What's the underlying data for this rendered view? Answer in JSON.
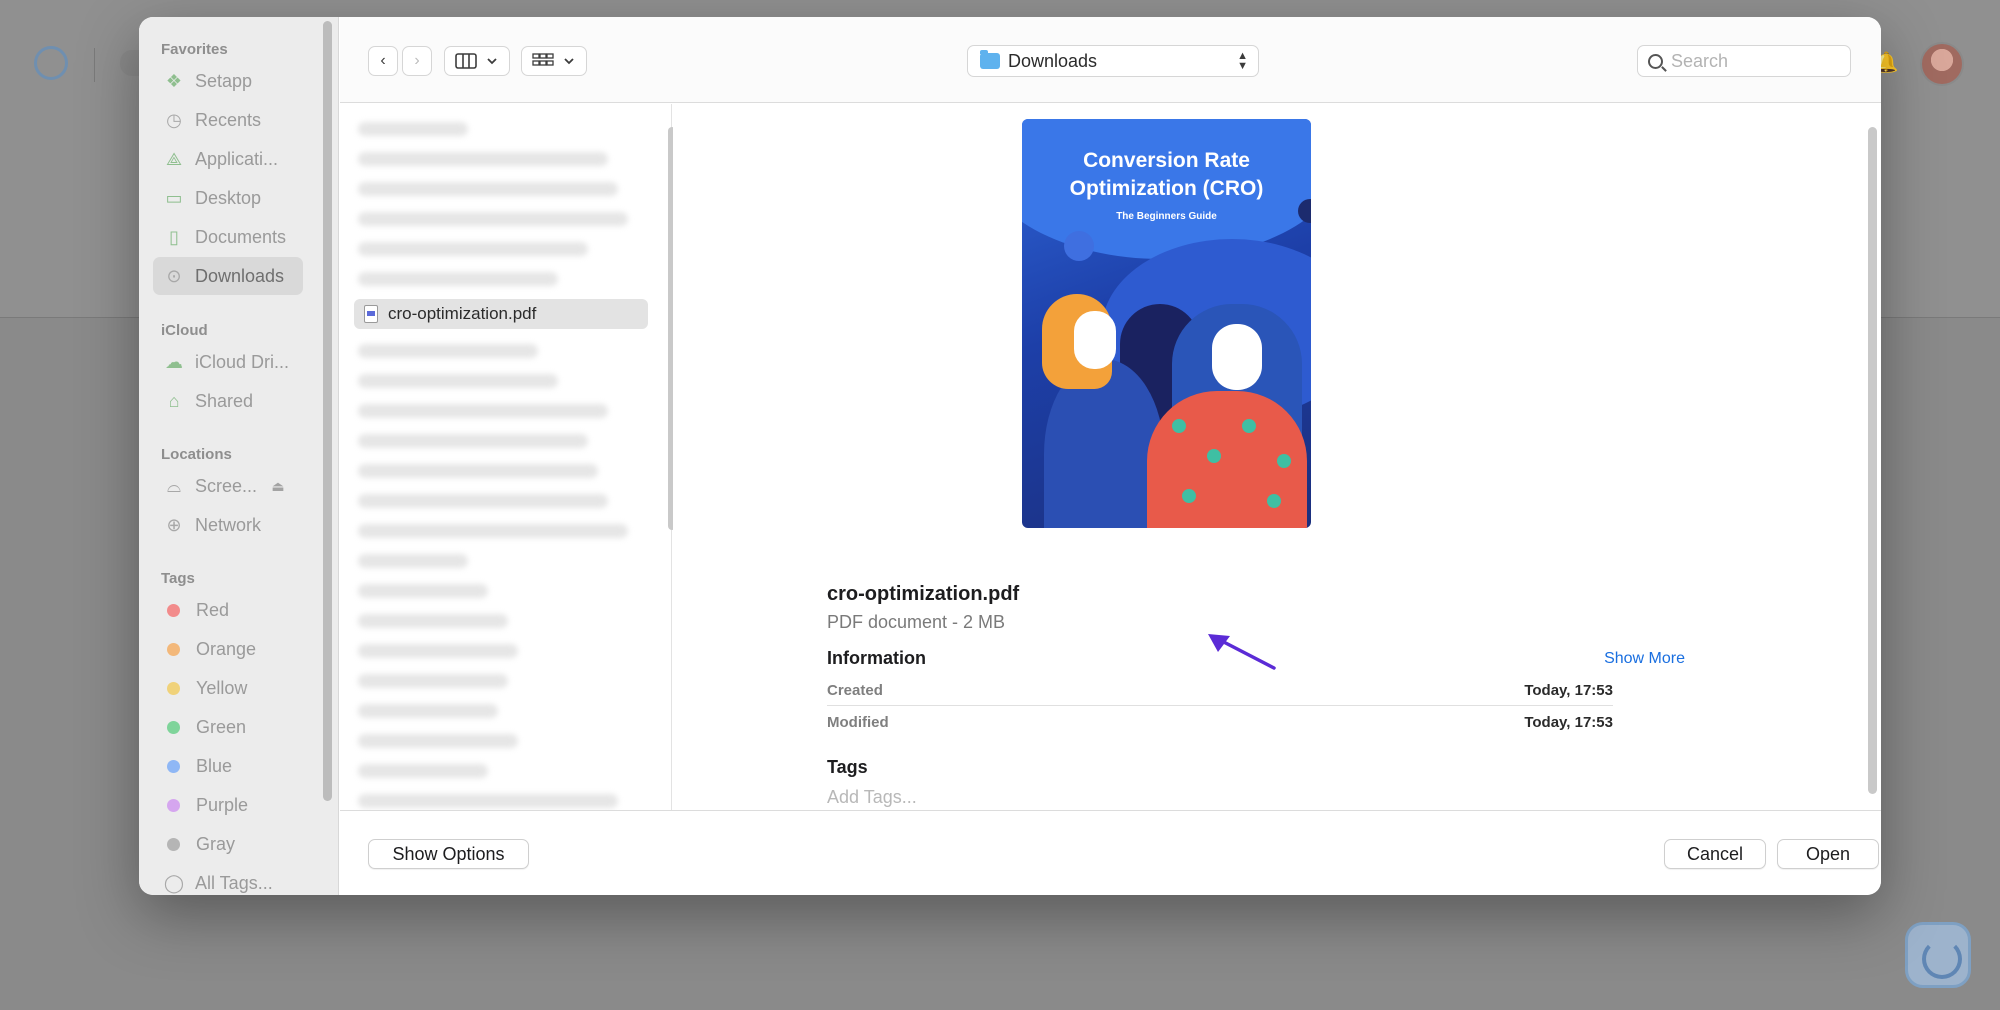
{
  "sidebar": {
    "sections": {
      "favorites": "Favorites",
      "icloud": "iCloud",
      "locations": "Locations",
      "tags": "Tags"
    },
    "favorites": [
      {
        "label": "Setapp",
        "icon": "setapp-icon"
      },
      {
        "label": "Recents",
        "icon": "clock-icon"
      },
      {
        "label": "Applicati...",
        "icon": "applications-icon"
      },
      {
        "label": "Desktop",
        "icon": "desktop-icon"
      },
      {
        "label": "Documents",
        "icon": "document-icon"
      },
      {
        "label": "Downloads",
        "icon": "download-icon",
        "selected": true
      }
    ],
    "icloud": [
      {
        "label": "iCloud Dri...",
        "icon": "cloud-icon"
      },
      {
        "label": "Shared",
        "icon": "shared-folder-icon"
      }
    ],
    "locations": [
      {
        "label": "Scree...",
        "icon": "drive-icon"
      },
      {
        "label": "Network",
        "icon": "globe-icon"
      }
    ],
    "tags": [
      {
        "label": "Red",
        "color": "#f28b8b"
      },
      {
        "label": "Orange",
        "color": "#f3b87a"
      },
      {
        "label": "Yellow",
        "color": "#f0d27a"
      },
      {
        "label": "Green",
        "color": "#7fd49a"
      },
      {
        "label": "Blue",
        "color": "#8fb7f5"
      },
      {
        "label": "Purple",
        "color": "#d5a6ef"
      },
      {
        "label": "Gray",
        "color": "#b5b5b5"
      },
      {
        "label": "All Tags...",
        "icon": "tags-icon"
      }
    ]
  },
  "toolbar": {
    "back_icon": "‹",
    "forward_icon": "›",
    "path_folder": "Downloads",
    "search_placeholder": "Search"
  },
  "file_list": {
    "selected_file": "cro-optimization.pdf"
  },
  "preview": {
    "thumbnail_title": "Conversion Rate Optimization (CRO)",
    "thumbnail_subtitle": "The Beginners Guide",
    "file_name": "cro-optimization.pdf",
    "file_kind": "PDF document - 2 MB",
    "information_heading": "Information",
    "show_more": "Show More",
    "info_rows": [
      {
        "key": "Created",
        "value": "Today, 17:53"
      },
      {
        "key": "Modified",
        "value": "Today, 17:53"
      }
    ],
    "tags_heading": "Tags",
    "add_tags_placeholder": "Add Tags..."
  },
  "bottom": {
    "show_options": "Show Options",
    "cancel": "Cancel",
    "open": "Open"
  },
  "colors": {
    "accent_link": "#1a6fe0",
    "annotation_arrow": "#5b2bd6"
  }
}
